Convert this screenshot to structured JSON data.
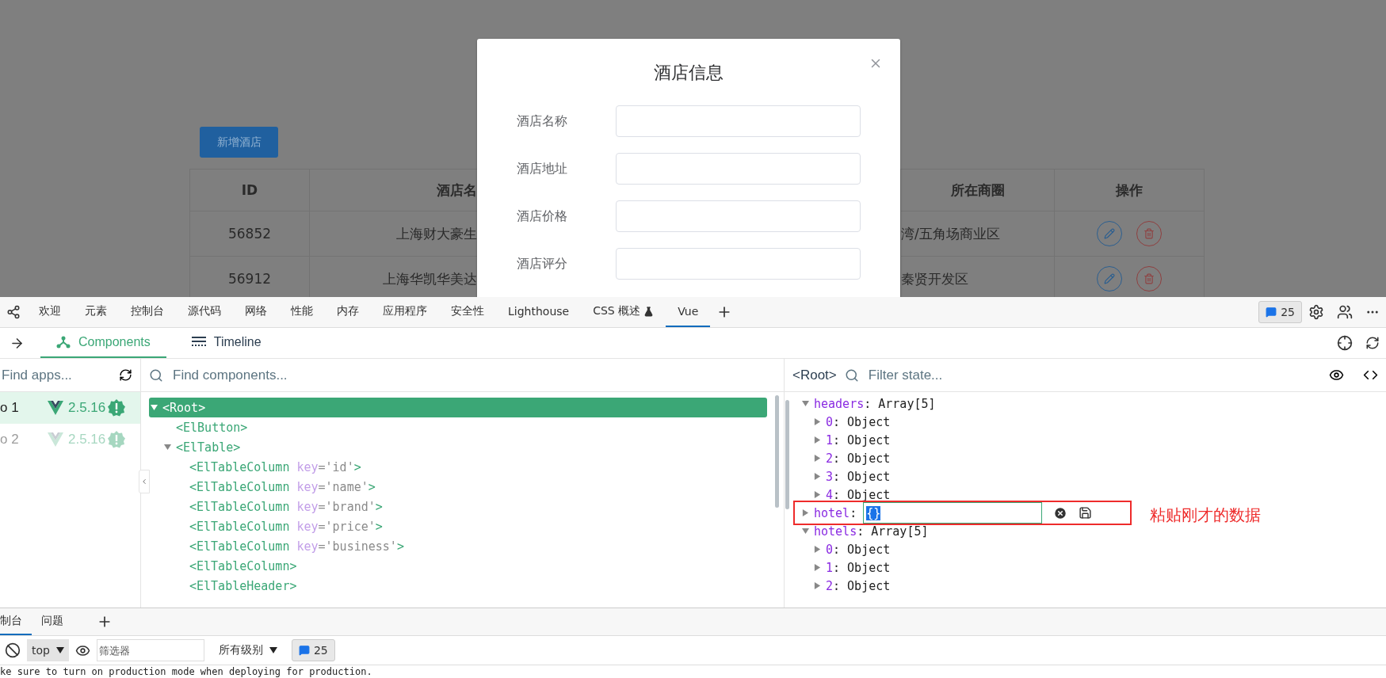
{
  "page": {
    "add_button": "新增酒店",
    "table": {
      "columns": [
        "ID",
        "酒店名",
        "所在商圈",
        "操作"
      ],
      "rows": [
        {
          "id": "56852",
          "name": "上海财大豪生",
          "business": "湾/五角场商业区"
        },
        {
          "id": "56912",
          "name": "上海华凯华美达",
          "business": "秦贤开发区"
        }
      ]
    }
  },
  "dialog": {
    "title": "酒店信息",
    "fields": [
      {
        "label": "酒店名称"
      },
      {
        "label": "酒店地址"
      },
      {
        "label": "酒店价格"
      },
      {
        "label": "酒店评分"
      }
    ]
  },
  "devtools": {
    "tabs": [
      {
        "label": "欢迎",
        "selected": false,
        "experimental": false
      },
      {
        "label": "元素",
        "selected": false,
        "experimental": false
      },
      {
        "label": "控制台",
        "selected": false,
        "experimental": false
      },
      {
        "label": "源代码",
        "selected": false,
        "experimental": false
      },
      {
        "label": "网络",
        "selected": false,
        "experimental": false
      },
      {
        "label": "性能",
        "selected": false,
        "experimental": false
      },
      {
        "label": "内存",
        "selected": false,
        "experimental": false
      },
      {
        "label": "应用程序",
        "selected": false,
        "experimental": false
      },
      {
        "label": "安全性",
        "selected": false,
        "experimental": false
      },
      {
        "label": "Lighthouse",
        "selected": false,
        "experimental": false
      },
      {
        "label": "CSS 概述",
        "selected": false,
        "experimental": true
      },
      {
        "label": "Vue",
        "selected": true,
        "experimental": false
      }
    ],
    "message_count": "25",
    "vue": {
      "tabs": [
        {
          "label": "Components",
          "selected": true
        },
        {
          "label": "Timeline",
          "selected": false
        }
      ],
      "apps_search": {
        "placeholder": "Find apps..."
      },
      "apps": [
        {
          "name": "o 1",
          "version": "2.5.16",
          "selected": true
        },
        {
          "name": "o 2",
          "version": "2.5.16",
          "selected": false
        }
      ],
      "components_search": {
        "placeholder": "Find components..."
      },
      "tree": [
        {
          "name": "<Root>",
          "selected": true,
          "expanded": true,
          "children": [
            {
              "name": "<ElButton>",
              "selected": false
            },
            {
              "name": "<ElTable>",
              "selected": false,
              "expanded": true,
              "children": [
                {
                  "name": "<ElTableColumn",
                  "attr_name": "key",
                  "attr_value": "='id'",
                  "close": ">",
                  "selected": false
                },
                {
                  "name": "<ElTableColumn",
                  "attr_name": "key",
                  "attr_value": "='name'",
                  "close": ">",
                  "selected": false
                },
                {
                  "name": "<ElTableColumn",
                  "attr_name": "key",
                  "attr_value": "='brand'",
                  "close": ">",
                  "selected": false
                },
                {
                  "name": "<ElTableColumn",
                  "attr_name": "key",
                  "attr_value": "='price'",
                  "close": ">",
                  "selected": false
                },
                {
                  "name": "<ElTableColumn",
                  "attr_name": "key",
                  "attr_value": "='business'",
                  "close": ">",
                  "selected": false
                },
                {
                  "name": "<ElTableColumn>",
                  "selected": false
                },
                {
                  "name": "<ElTableHeader>",
                  "selected": false
                }
              ]
            }
          ]
        }
      ],
      "state_root": "<Root>",
      "state_filter": {
        "placeholder": "Filter state..."
      },
      "state": [
        {
          "key": "headers",
          "value": ": Array[5]",
          "expanded": true,
          "children": [
            {
              "key": "0",
              "value": ": Object",
              "expanded": false
            },
            {
              "key": "1",
              "value": ": Object",
              "expanded": false
            },
            {
              "key": "2",
              "value": ": Object",
              "expanded": false
            },
            {
              "key": "3",
              "value": ": Object",
              "expanded": false
            },
            {
              "key": "4",
              "value": ": Object",
              "expanded": false
            }
          ]
        },
        {
          "key": "hotel",
          "value": ":",
          "expanded": false,
          "kind": "edit",
          "input": "{}"
        },
        {
          "key": "hotels",
          "value": ": Array[5]",
          "expanded": true,
          "children": [
            {
              "key": "0",
              "value": ": Object",
              "expanded": false
            },
            {
              "key": "1",
              "value": ": Object",
              "expanded": false
            },
            {
              "key": "2",
              "value": ": Object",
              "expanded": false
            }
          ]
        }
      ],
      "annotation": "粘贴刚才的数据"
    },
    "drawer": {
      "tabs": [
        {
          "label": "制台",
          "selected": true
        },
        {
          "label": "问题",
          "selected": false
        }
      ],
      "context": "top",
      "filter": {
        "placeholder": "筛选器"
      },
      "levels": "所有级别",
      "count": "25",
      "messages": [
        "ke sure to turn on production mode when deploying for production."
      ]
    }
  }
}
